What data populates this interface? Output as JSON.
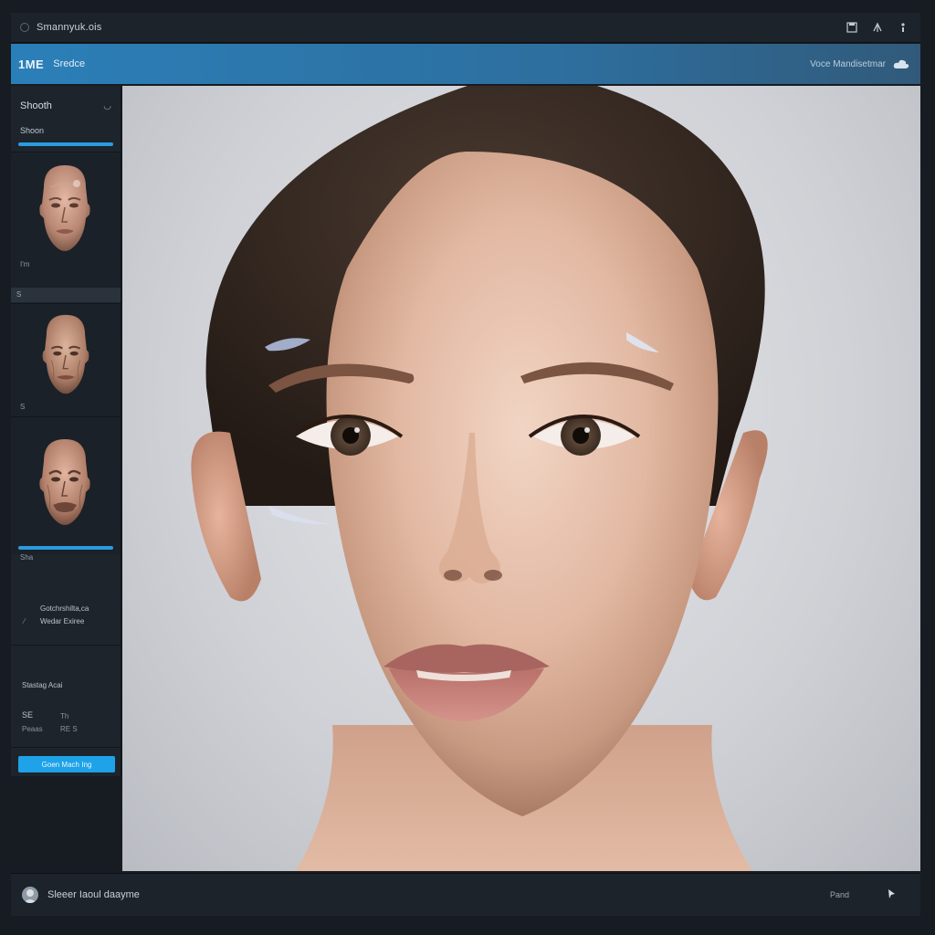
{
  "window": {
    "title": "Smannyuk.ois"
  },
  "toolbar": {
    "logo": "1ME",
    "section": "Sredce",
    "right_text": "Voce Mandisetmar"
  },
  "sidebar": {
    "header": "Shooth",
    "subheader": "Shoon",
    "thumb1_caption": "I'm",
    "divider1_label": "S",
    "thumb2_caption": "S",
    "thumb3_caption": "Sha",
    "info_title": "Gotchrshilta,ca",
    "info_sub": "Wedar Exiree",
    "stats_title": "Stastag Acai",
    "stat_label_1": "SE",
    "stat_value_1": "Th",
    "stat_label_2": "Peaas",
    "stat_value_2": "RE S",
    "action_button": "Goen Mach Ing"
  },
  "status": {
    "text": "Sleeer Iaoul daayme",
    "right": "Pand"
  },
  "colors": {
    "accent": "#2a9be0",
    "toolbar": "#2b7fb8",
    "panel": "#1d242c"
  }
}
